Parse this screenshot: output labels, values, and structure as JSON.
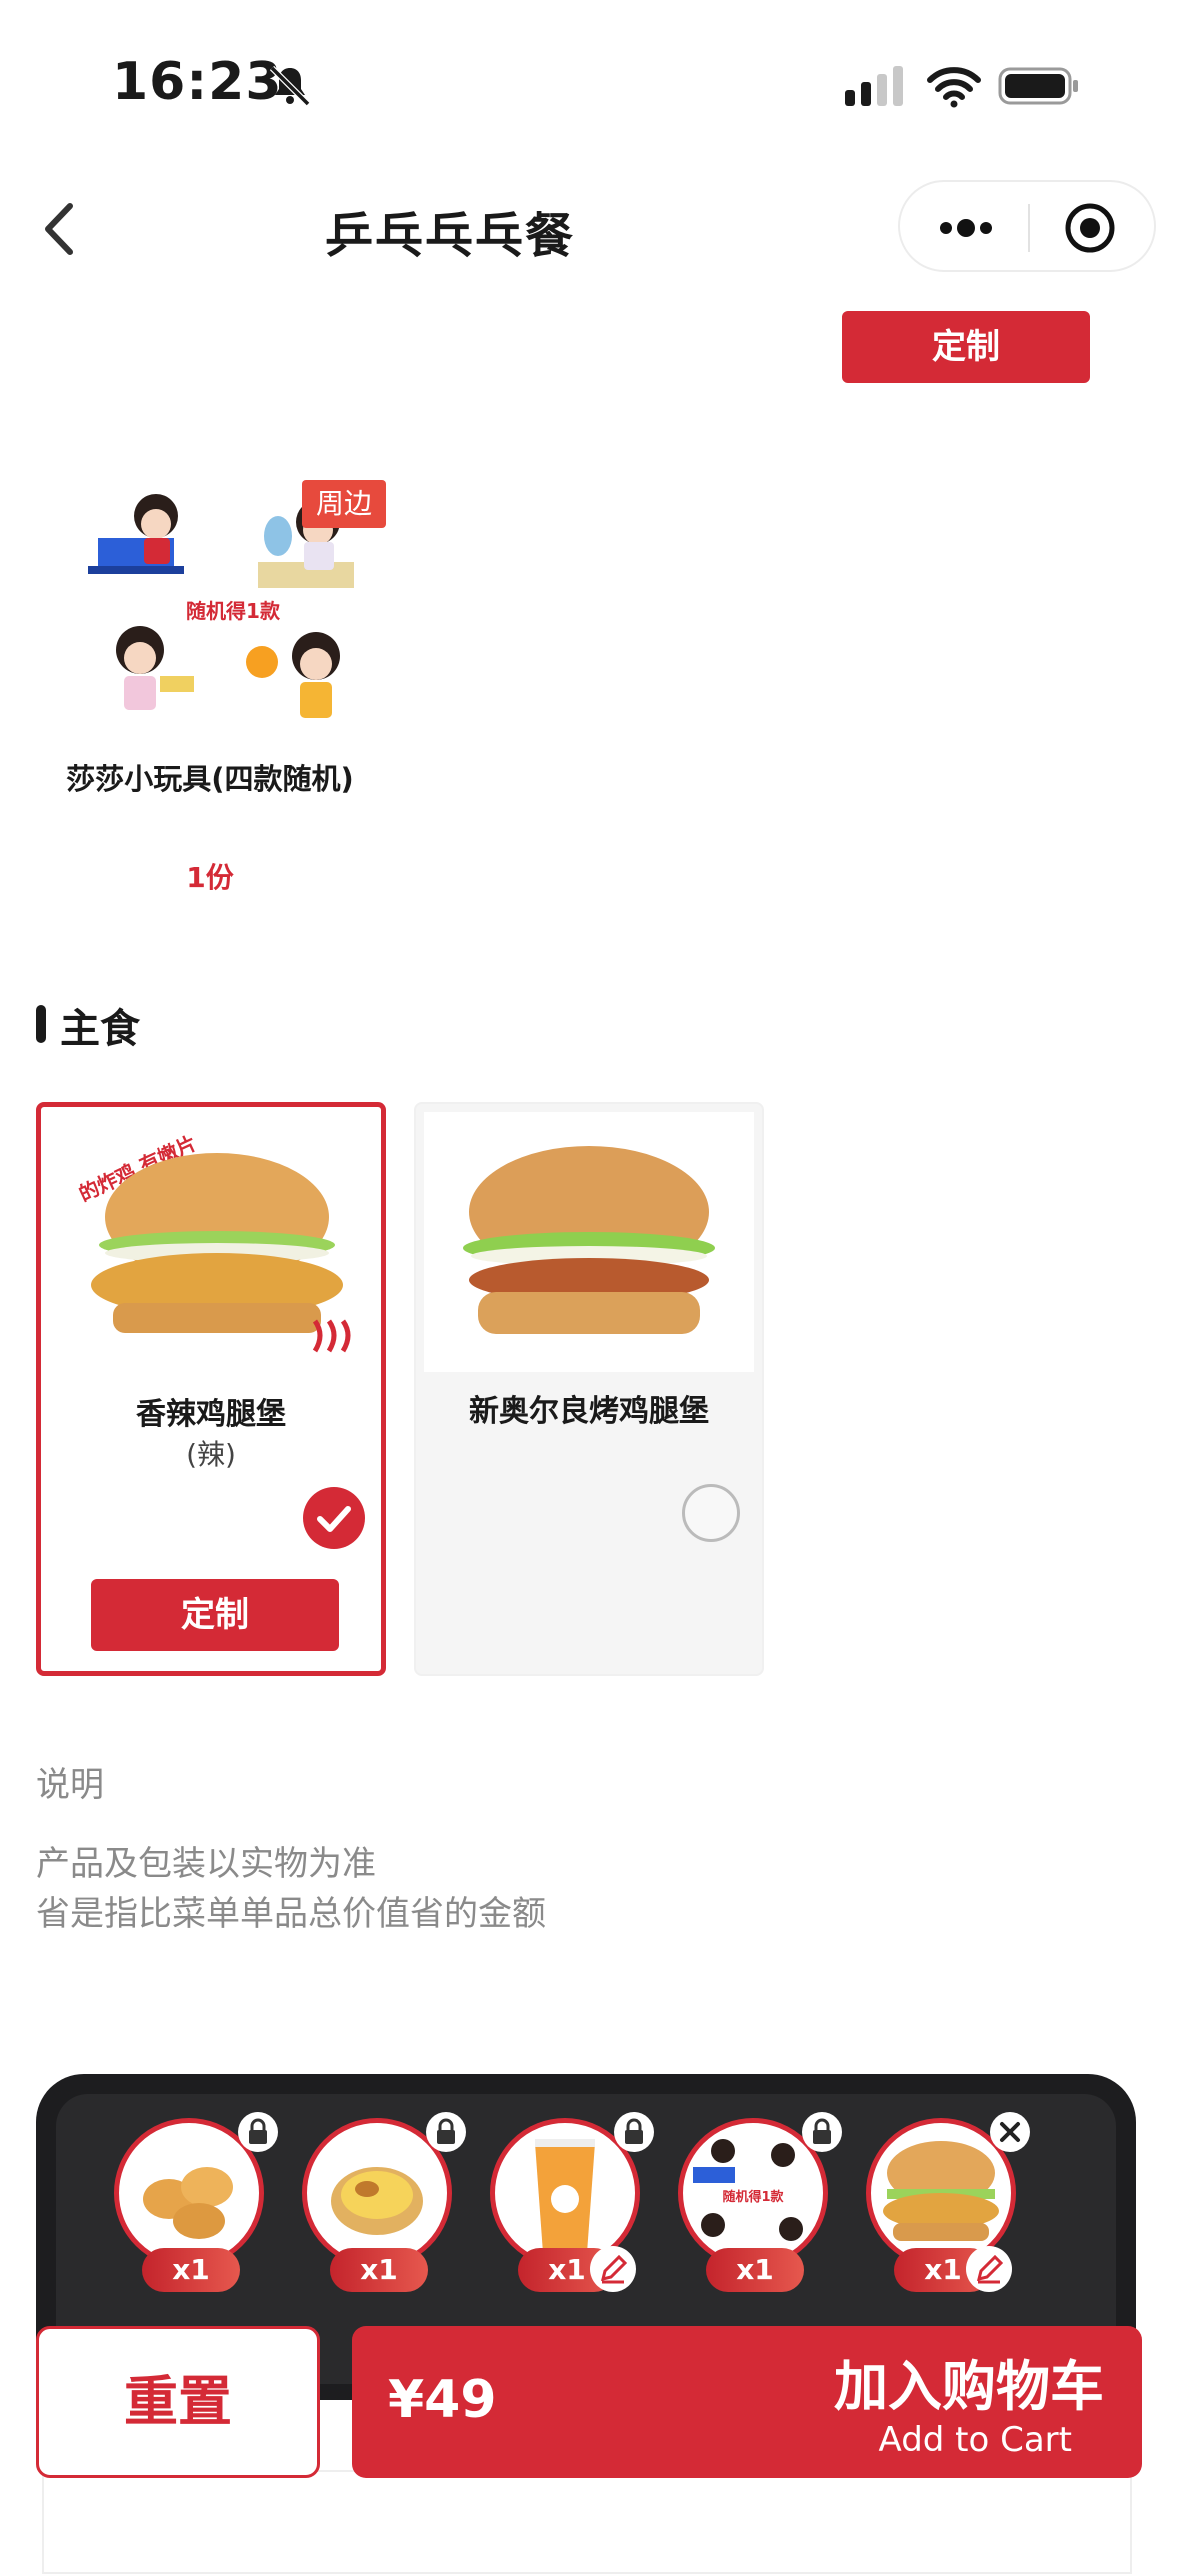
{
  "status_bar": {
    "time": "16:23"
  },
  "nav": {
    "title": "乒乓乓乓餐"
  },
  "top_custom_label": "定制",
  "toy": {
    "badge": "周边",
    "image_caption": "随机得1款",
    "name": "莎莎小玩具(四款随机)",
    "qty": "1份"
  },
  "section": {
    "title": "主食"
  },
  "options": [
    {
      "name": "香辣鸡腿堡",
      "sub": "(辣)",
      "badge_text": "的炸鸡 有嫩片",
      "selected": true,
      "custom_label": "定制"
    },
    {
      "name": "新奥尔良烤鸡腿堡",
      "selected": false
    }
  ],
  "notes": {
    "title": "说明",
    "line1": "产品及包装以实物为准",
    "line2": "省是指比菜单单品总价值省的金额"
  },
  "tray": {
    "items": [
      {
        "item": "nuggets",
        "qty": "x1",
        "badge": "lock-icon"
      },
      {
        "item": "egg-tart",
        "qty": "x1",
        "badge": "lock-icon"
      },
      {
        "item": "drink",
        "qty": "x1",
        "badge": "lock-icon",
        "editable": true
      },
      {
        "item": "toy",
        "qty": "x1",
        "badge": "lock-icon",
        "caption": "随机得1款"
      },
      {
        "item": "burger",
        "qty": "x1",
        "badge": "close-icon",
        "editable": true
      }
    ]
  },
  "actions": {
    "reset": "重置",
    "price": "¥49",
    "add_cn": "加入购物车",
    "add_en": "Add to Cart"
  },
  "colors": {
    "accent": "#d42a36",
    "tray": "#1d1d1f"
  }
}
